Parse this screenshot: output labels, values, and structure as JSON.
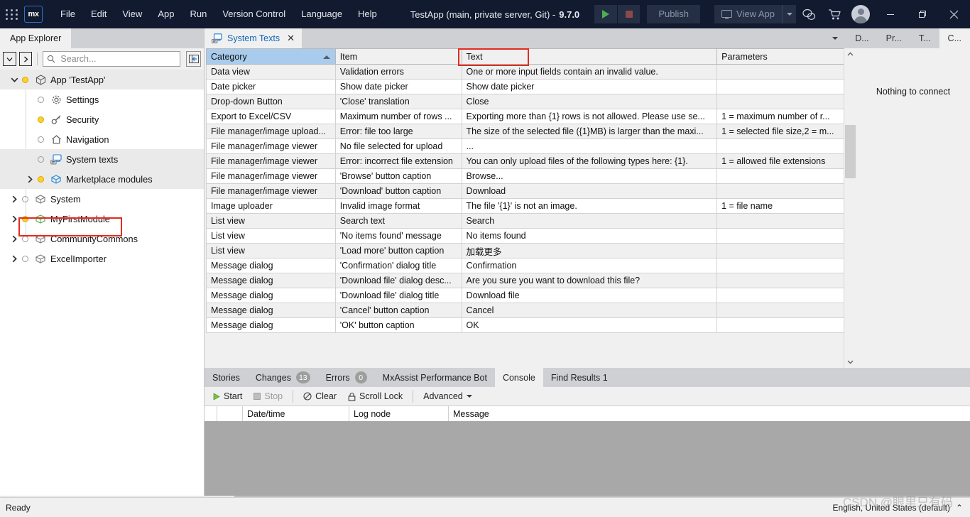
{
  "titlebar": {
    "logo": "mx",
    "menus": [
      "File",
      "Edit",
      "View",
      "App",
      "Run",
      "Version Control",
      "Language",
      "Help"
    ],
    "app_title": "TestApp (main, private server, Git)  -",
    "version": "9.7.0",
    "publish_label": "Publish",
    "view_app_label": "View App",
    "icons": [
      "run-icon",
      "stop-icon",
      "feedback-icon",
      "marketplace-cart-icon",
      "user-avatar-icon",
      "minimize-icon",
      "restore-icon",
      "close-icon"
    ]
  },
  "sidebar": {
    "tab_label": "App Explorer",
    "search_placeholder": "Search...",
    "search_value": "",
    "tree": [
      {
        "label": "App 'TestApp'",
        "indent": 0,
        "twisty": "⌄",
        "dot": "yellow",
        "icon": "package-icon",
        "selected": true,
        "highlight": false
      },
      {
        "label": "Settings",
        "indent": 1,
        "twisty": "",
        "dot": "empty",
        "icon": "gear-icon",
        "selected": false,
        "highlight": false
      },
      {
        "label": "Security",
        "indent": 1,
        "twisty": "",
        "dot": "yellow",
        "icon": "key-icon",
        "selected": false,
        "highlight": false
      },
      {
        "label": "Navigation",
        "indent": 1,
        "twisty": "",
        "dot": "empty",
        "icon": "home-icon",
        "selected": false,
        "highlight": false
      },
      {
        "label": "System texts",
        "indent": 1,
        "twisty": "",
        "dot": "empty",
        "icon": "system-texts-icon",
        "selected": true,
        "highlight": true
      },
      {
        "label": "Marketplace modules",
        "indent": 1,
        "twisty": "›",
        "dot": "yellow",
        "icon": "module-icon",
        "selected": true,
        "highlight": false
      },
      {
        "label": "System",
        "indent": 0,
        "twisty": "›",
        "dot": "empty",
        "icon": "module-icon",
        "selected": false,
        "highlight": false
      },
      {
        "label": "MyFirstModule",
        "indent": 0,
        "twisty": "›",
        "dot": "yellow",
        "icon": "module-green-icon",
        "selected": false,
        "highlight": false
      },
      {
        "label": "CommunityCommons",
        "indent": 0,
        "twisty": "›",
        "dot": "empty",
        "icon": "module-icon",
        "selected": false,
        "highlight": false
      },
      {
        "label": "ExcelImporter",
        "indent": 0,
        "twisty": "›",
        "dot": "empty",
        "icon": "module-icon",
        "selected": false,
        "highlight": false
      }
    ]
  },
  "editor": {
    "tab_label": "System Texts",
    "tab_icon": "system-texts-icon",
    "tab_close": "✕",
    "right_tabs": [
      "D...",
      "Pr...",
      "T...",
      "C..."
    ],
    "right_tab_active": "C...",
    "right_pane_message": "Nothing to connect",
    "columns": [
      "Category",
      "Item",
      "Text",
      "Parameters"
    ],
    "sorted_column": "Category",
    "highlighted_column": "Text",
    "rows": [
      [
        "Data view",
        "Validation errors",
        "One or more input fields contain an invalid value.",
        ""
      ],
      [
        "Date picker",
        "Show date picker",
        "Show date picker",
        ""
      ],
      [
        "Drop-down Button",
        "'Close' translation",
        "Close",
        ""
      ],
      [
        "Export to Excel/CSV",
        "Maximum number of rows ...",
        "Exporting more than {1} rows is not allowed. Please use se...",
        "1 = maximum number of r..."
      ],
      [
        "File manager/image upload...",
        "Error: file too large",
        "The size of the selected file ({1}MB) is larger than the maxi...",
        "1 = selected file size,2 = m..."
      ],
      [
        "File manager/image viewer",
        "No file selected for upload",
        "...",
        ""
      ],
      [
        "File manager/image viewer",
        "Error: incorrect file extension",
        "You can only upload files of the following types here: {1}.",
        "1 = allowed file extensions"
      ],
      [
        "File manager/image viewer",
        "'Browse' button caption",
        "Browse...",
        ""
      ],
      [
        "File manager/image viewer",
        "'Download' button caption",
        "Download",
        ""
      ],
      [
        "Image uploader",
        "Invalid image format",
        "The file '{1}' is not an image.",
        "1 = file name"
      ],
      [
        "List view",
        "Search text",
        "Search",
        ""
      ],
      [
        "List view",
        "'No items found' message",
        "No items found",
        ""
      ],
      [
        "List view",
        "'Load more' button caption",
        "加载更多",
        ""
      ],
      [
        "Message dialog",
        "'Confirmation' dialog title",
        "Confirmation",
        ""
      ],
      [
        "Message dialog",
        "'Download file' dialog desc...",
        "Are you sure you want to download this file?",
        ""
      ],
      [
        "Message dialog",
        "'Download file' dialog title",
        "Download file",
        ""
      ],
      [
        "Message dialog",
        "'Cancel' button caption",
        "Cancel",
        ""
      ],
      [
        "Message dialog",
        "'OK' button caption",
        "OK",
        ""
      ]
    ]
  },
  "console": {
    "tabs": [
      {
        "label": "Stories",
        "badge": ""
      },
      {
        "label": "Changes",
        "badge": "13"
      },
      {
        "label": "Errors",
        "badge": "0"
      },
      {
        "label": "MxAssist Performance Bot",
        "badge": ""
      },
      {
        "label": "Console",
        "badge": ""
      },
      {
        "label": "Find Results 1",
        "badge": ""
      }
    ],
    "active_tab": "Console",
    "toolbar": [
      {
        "label": "Start",
        "icon": "play-icon",
        "disabled": false
      },
      {
        "label": "Stop",
        "icon": "stop-icon",
        "disabled": true
      },
      {
        "label": "Clear",
        "icon": "clear-icon",
        "disabled": false
      },
      {
        "label": "Scroll Lock",
        "icon": "lock-icon",
        "disabled": false
      },
      {
        "label": "Advanced",
        "icon": "chevron-down-icon",
        "disabled": false
      }
    ],
    "columns": [
      "",
      "",
      "Date/time",
      "Log node",
      "Message"
    ],
    "rows": []
  },
  "statusbar": {
    "status": "Ready",
    "language": "English, United States (default)",
    "expander": "⌃"
  },
  "watermark": "CSDN @眼里只有码",
  "colors": {
    "titlebar_bg": "#111a2e",
    "accent_blue": "#1465b8",
    "highlight_red": "#e42b20",
    "sorted_header": "#a9cced",
    "yellow_dot": "#ffd027"
  }
}
